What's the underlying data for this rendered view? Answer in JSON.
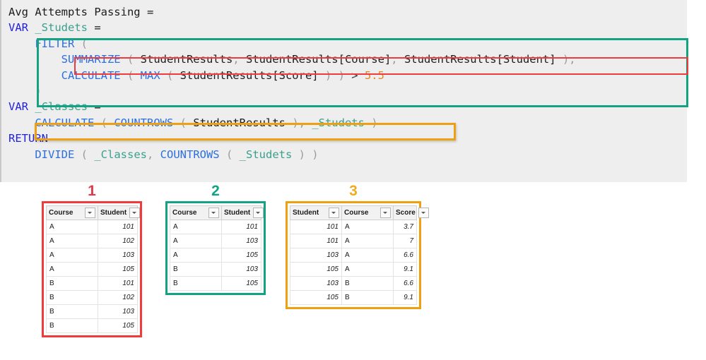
{
  "code": {
    "lines": [
      [
        {
          "t": "plain",
          "s": "Avg Attempts Passing ="
        }
      ],
      [
        {
          "t": "kw",
          "s": "VAR"
        },
        {
          "t": "plain",
          "s": " "
        },
        {
          "t": "var",
          "s": "_Studets"
        },
        {
          "t": "plain",
          "s": " ="
        }
      ],
      [
        {
          "t": "plain",
          "s": "    "
        },
        {
          "t": "fn",
          "s": "FILTER"
        },
        {
          "t": "paren",
          "s": " ("
        }
      ],
      [
        {
          "t": "plain",
          "s": "        "
        },
        {
          "t": "fn",
          "s": "SUMMARIZE"
        },
        {
          "t": "paren",
          "s": " ( "
        },
        {
          "t": "tbl",
          "s": "StudentResults"
        },
        {
          "t": "paren",
          "s": ", "
        },
        {
          "t": "tbl",
          "s": "StudentResults[Course]"
        },
        {
          "t": "paren",
          "s": ", "
        },
        {
          "t": "tbl",
          "s": "StudentResults[Student]"
        },
        {
          "t": "paren",
          "s": " ),"
        }
      ],
      [
        {
          "t": "plain",
          "s": "        "
        },
        {
          "t": "fn",
          "s": "CALCULATE"
        },
        {
          "t": "paren",
          "s": " ( "
        },
        {
          "t": "fn",
          "s": "MAX"
        },
        {
          "t": "paren",
          "s": " ( "
        },
        {
          "t": "tbl",
          "s": "StudentResults[Score]"
        },
        {
          "t": "paren",
          "s": " ) )"
        },
        {
          "t": "op",
          "s": " > "
        },
        {
          "t": "num",
          "s": "5.5"
        }
      ],
      [
        {
          "t": "plain",
          "s": "    "
        },
        {
          "t": "paren",
          "s": ")"
        }
      ],
      [
        {
          "t": "kw",
          "s": "VAR"
        },
        {
          "t": "plain",
          "s": " "
        },
        {
          "t": "var",
          "s": "_Classes"
        },
        {
          "t": "plain",
          "s": " ="
        }
      ],
      [
        {
          "t": "plain",
          "s": "    "
        },
        {
          "t": "fn",
          "s": "CALCULATE"
        },
        {
          "t": "paren",
          "s": " ( "
        },
        {
          "t": "fn",
          "s": "COUNTROWS"
        },
        {
          "t": "paren",
          "s": " ( "
        },
        {
          "t": "tbl",
          "s": "StudentResults"
        },
        {
          "t": "paren",
          "s": " ), "
        },
        {
          "t": "var",
          "s": "_Studets"
        },
        {
          "t": "paren",
          "s": " )"
        }
      ],
      [
        {
          "t": "kw",
          "s": "RETURN"
        }
      ],
      [
        {
          "t": "plain",
          "s": "    "
        },
        {
          "t": "fn",
          "s": "DIVIDE"
        },
        {
          "t": "paren",
          "s": " ( "
        },
        {
          "t": "var",
          "s": "_Classes"
        },
        {
          "t": "paren",
          "s": ", "
        },
        {
          "t": "fn",
          "s": "COUNTROWS"
        },
        {
          "t": "paren",
          "s": " ( "
        },
        {
          "t": "var",
          "s": "_Studets"
        },
        {
          "t": "paren",
          "s": " ) )"
        }
      ]
    ],
    "highlights": [
      {
        "name": "filter-expression-highlight",
        "color": "#13a383"
      },
      {
        "name": "summarize-expression-highlight",
        "color": "#ef3b3b"
      },
      {
        "name": "calculate-expression-highlight",
        "color": "#eda112"
      }
    ]
  },
  "tables": [
    {
      "label": "1",
      "label_color": "#e03a4e",
      "border_color": "#ef3b3b",
      "columns": [
        "Course",
        "Student"
      ],
      "col_align": [
        "txt",
        "num"
      ],
      "rows": [
        [
          "A",
          "101"
        ],
        [
          "A",
          "102"
        ],
        [
          "A",
          "103"
        ],
        [
          "A",
          "105"
        ],
        [
          "B",
          "101"
        ],
        [
          "B",
          "102"
        ],
        [
          "B",
          "103"
        ],
        [
          "B",
          "105"
        ]
      ]
    },
    {
      "label": "2",
      "label_color": "#12a383",
      "border_color": "#13a383",
      "columns": [
        "Course",
        "Student"
      ],
      "col_align": [
        "txt",
        "num"
      ],
      "rows": [
        [
          "A",
          "101"
        ],
        [
          "A",
          "103"
        ],
        [
          "A",
          "105"
        ],
        [
          "B",
          "103"
        ],
        [
          "B",
          "105"
        ]
      ]
    },
    {
      "label": "3",
      "label_color": "#eeac1e",
      "border_color": "#eda112",
      "columns": [
        "Student",
        "Course",
        "Score"
      ],
      "col_align": [
        "num",
        "txt",
        "num"
      ],
      "rows": [
        [
          "101",
          "A",
          "3.7"
        ],
        [
          "101",
          "A",
          "7"
        ],
        [
          "103",
          "A",
          "6.6"
        ],
        [
          "105",
          "A",
          "9.1"
        ],
        [
          "103",
          "B",
          "6.6"
        ],
        [
          "105",
          "B",
          "9.1"
        ]
      ]
    }
  ]
}
